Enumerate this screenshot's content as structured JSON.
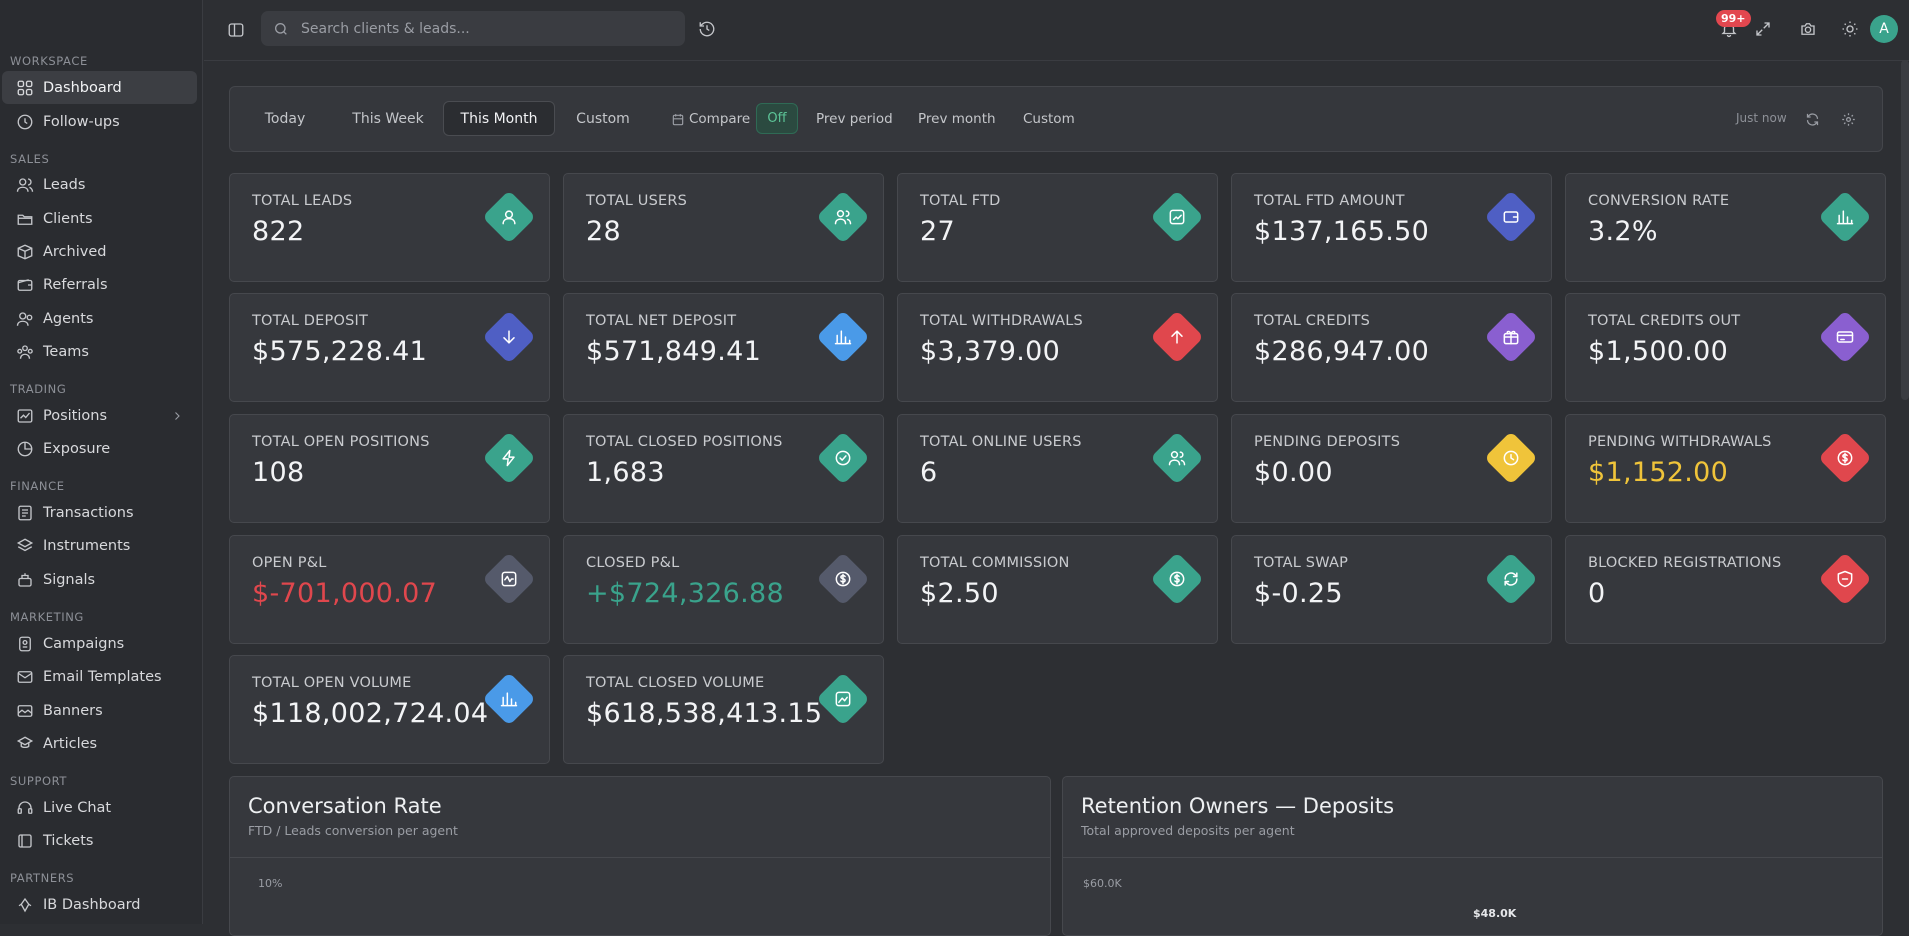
{
  "sidebar": {
    "sections": [
      {
        "label": "WORKSPACE"
      },
      {
        "label": "SALES"
      },
      {
        "label": "TRADING"
      },
      {
        "label": "FINANCE"
      },
      {
        "label": "MARKETING"
      },
      {
        "label": "SUPPORT"
      },
      {
        "label": "PARTNERS"
      }
    ],
    "items": [
      {
        "label": "Dashboard",
        "icon": "grid-icon"
      },
      {
        "label": "Follow-ups",
        "icon": "clock-icon"
      },
      {
        "label": "Leads",
        "icon": "users-icon"
      },
      {
        "label": "Clients",
        "icon": "folder-icon"
      },
      {
        "label": "Archived",
        "icon": "box-icon"
      },
      {
        "label": "Referrals",
        "icon": "wallet-icon"
      },
      {
        "label": "Agents",
        "icon": "agents-icon"
      },
      {
        "label": "Teams",
        "icon": "teams-icon"
      },
      {
        "label": "Positions",
        "icon": "chart-line-icon"
      },
      {
        "label": "Exposure",
        "icon": "pie-icon"
      },
      {
        "label": "Transactions",
        "icon": "list-icon"
      },
      {
        "label": "Instruments",
        "icon": "layers-icon"
      },
      {
        "label": "Signals",
        "icon": "signal-icon"
      },
      {
        "label": "Campaigns",
        "icon": "campaign-icon"
      },
      {
        "label": "Email Templates",
        "icon": "mail-icon"
      },
      {
        "label": "Banners",
        "icon": "banner-icon"
      },
      {
        "label": "Articles",
        "icon": "article-icon"
      },
      {
        "label": "Live Chat",
        "icon": "headset-icon"
      },
      {
        "label": "Tickets",
        "icon": "ticket-icon"
      },
      {
        "label": "IB Dashboard",
        "icon": "ib-icon"
      }
    ]
  },
  "topbar": {
    "search_placeholder": "Search clients & leads...",
    "notification_count": "99+",
    "avatar_initial": "A"
  },
  "filters": {
    "periods": [
      "Today",
      "This Week",
      "This Month",
      "Custom"
    ],
    "active_period": "This Month",
    "compare_label": "Compare",
    "compare_state": "Off",
    "compare_options": [
      "Prev period",
      "Prev month",
      "Custom"
    ],
    "updated": "Just now"
  },
  "stats": [
    {
      "label": "TOTAL LEADS",
      "value": "822",
      "color": "#3aa38c",
      "icon": "user-icon"
    },
    {
      "label": "TOTAL USERS",
      "value": "28",
      "color": "#3aa38c",
      "icon": "users-icon"
    },
    {
      "label": "TOTAL FTD",
      "value": "27",
      "color": "#3aa38c",
      "icon": "trend-icon"
    },
    {
      "label": "TOTAL FTD AMOUNT",
      "value": "$137,165.50",
      "color": "#4f5fc4",
      "icon": "wallet-icon"
    },
    {
      "label": "CONVERSION RATE",
      "value": "3.2%",
      "color": "#3aa38c",
      "icon": "bar-chart-icon"
    },
    {
      "label": "TOTAL DEPOSIT",
      "value": "$575,228.41",
      "color": "#4f5fc4",
      "icon": "arrow-down-icon"
    },
    {
      "label": "TOTAL NET DEPOSIT",
      "value": "$571,849.41",
      "color": "#4a9ae8",
      "icon": "bar-chart-icon"
    },
    {
      "label": "TOTAL WITHDRAWALS",
      "value": "$3,379.00",
      "color": "#e0474d",
      "icon": "arrow-up-icon"
    },
    {
      "label": "TOTAL CREDITS",
      "value": "$286,947.00",
      "color": "#8a5fd0",
      "icon": "gift-icon"
    },
    {
      "label": "TOTAL CREDITS OUT",
      "value": "$1,500.00",
      "color": "#8a5fd0",
      "icon": "card-icon"
    },
    {
      "label": "TOTAL OPEN POSITIONS",
      "value": "108",
      "color": "#3aa38c",
      "icon": "bolt-icon"
    },
    {
      "label": "TOTAL CLOSED POSITIONS",
      "value": "1,683",
      "color": "#3aa38c",
      "icon": "check-circle-icon"
    },
    {
      "label": "TOTAL ONLINE USERS",
      "value": "6",
      "color": "#3aa38c",
      "icon": "users-icon"
    },
    {
      "label": "PENDING DEPOSITS",
      "value": "$0.00",
      "color": "#f0c43a",
      "icon": "clock-icon"
    },
    {
      "label": "PENDING WITHDRAWALS",
      "value": "$1,152.00",
      "color": "#e0474d",
      "icon": "dollar-circle-icon",
      "value_color": "#f0c43a"
    },
    {
      "label": "OPEN P&L",
      "value": "$-701,000.07",
      "color": "#555a6b",
      "icon": "pulse-icon",
      "value_color": "#e0474d"
    },
    {
      "label": "CLOSED P&L",
      "value": "+$724,326.88",
      "color": "#555a6b",
      "icon": "dollar-circle-icon",
      "value_color": "#3aa38c"
    },
    {
      "label": "TOTAL COMMISSION",
      "value": "$2.50",
      "color": "#3aa38c",
      "icon": "dollar-circle-icon"
    },
    {
      "label": "TOTAL SWAP",
      "value": "$-0.25",
      "color": "#3aa38c",
      "icon": "swap-icon"
    },
    {
      "label": "BLOCKED REGISTRATIONS",
      "value": "0",
      "color": "#e0474d",
      "icon": "shield-icon"
    },
    {
      "label": "TOTAL OPEN VOLUME",
      "value": "$118,002,724.04",
      "color": "#4a9ae8",
      "icon": "bar-chart-icon"
    },
    {
      "label": "TOTAL CLOSED VOLUME",
      "value": "$618,538,413.15",
      "color": "#3aa38c",
      "icon": "image-chart-icon"
    }
  ],
  "panels": [
    {
      "title": "Conversation Rate",
      "subtitle": "FTD / Leads conversion per agent",
      "axis_top": "10%"
    },
    {
      "title": "Retention Owners — Deposits",
      "subtitle": "Total approved deposits per agent",
      "axis_top": "$60.0K",
      "bar_label": "$48.0K"
    }
  ]
}
